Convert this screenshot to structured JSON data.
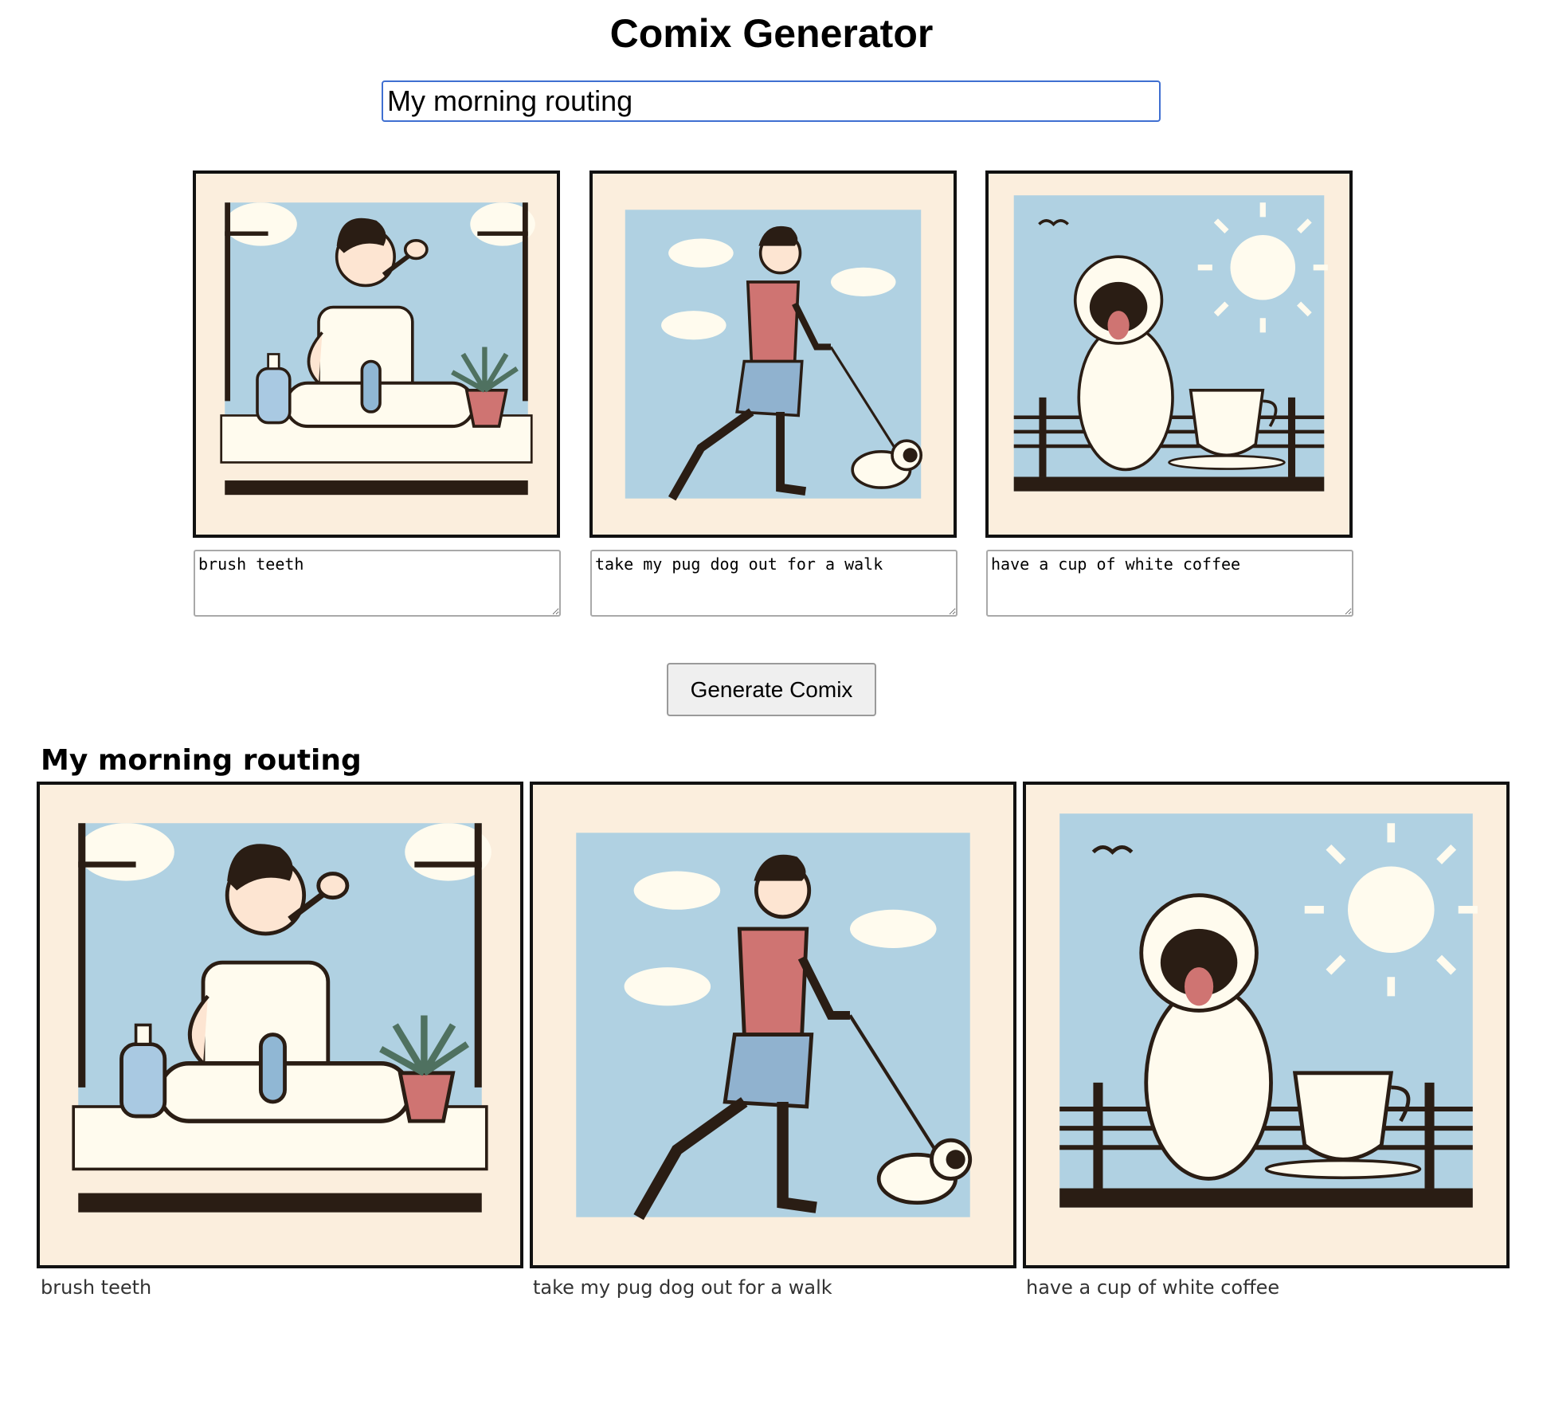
{
  "app": {
    "title": "Comix Generator"
  },
  "editor": {
    "title_value": "My morning routing",
    "panels": [
      {
        "text": "brush teeth"
      },
      {
        "text": "take my pug dog out for a walk"
      },
      {
        "text": "have a cup of white coffee"
      }
    ],
    "generate_label": "Generate Comix"
  },
  "comic": {
    "title": "My morning routing",
    "captions": [
      "brush teeth",
      "take my pug dog out for a walk",
      "have a cup of white coffee"
    ]
  },
  "colors": {
    "panel_background": "#fbeedd",
    "sky": "#b0d1e2",
    "outline": "#2a1d14",
    "shirt_red": "#cf7472",
    "cream": "#fffbee",
    "input_focus": "#3f6fd1"
  }
}
